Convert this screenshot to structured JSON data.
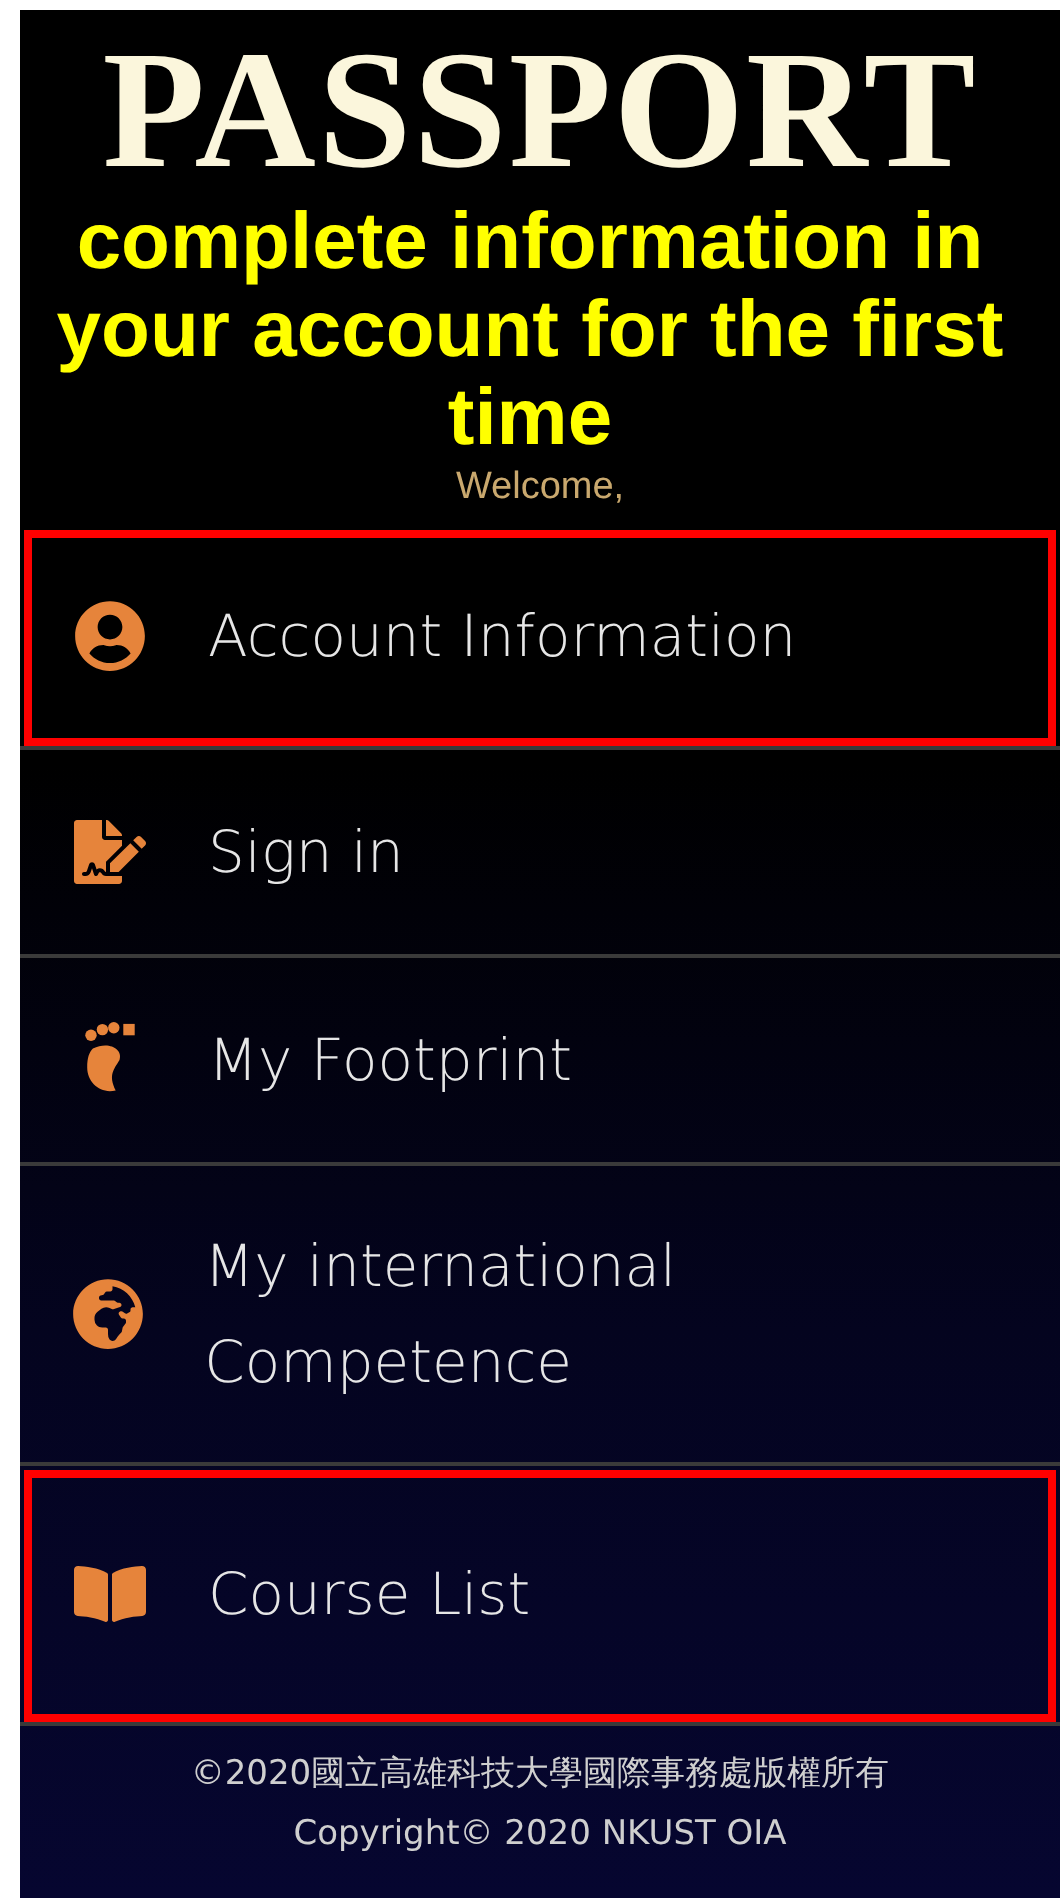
{
  "header": {
    "title": "PASSPORT",
    "welcome": "Welcome,"
  },
  "annotation": {
    "caption": "complete information in your account for the first time"
  },
  "menu": [
    {
      "kind": "account",
      "label": "Account Information",
      "highlighted": true
    },
    {
      "kind": "signin",
      "label": "Sign in",
      "highlighted": false
    },
    {
      "kind": "footprint",
      "label": "My Footprint",
      "highlighted": false
    },
    {
      "kind": "globe",
      "label": "My international Competence",
      "highlighted": false
    },
    {
      "kind": "book",
      "label": "Course List",
      "highlighted": true
    }
  ],
  "footer": {
    "lines": [
      "©2020國立高雄科技大學國際事務處版權所有",
      "Copyright© 2020 NKUST OIA"
    ]
  }
}
